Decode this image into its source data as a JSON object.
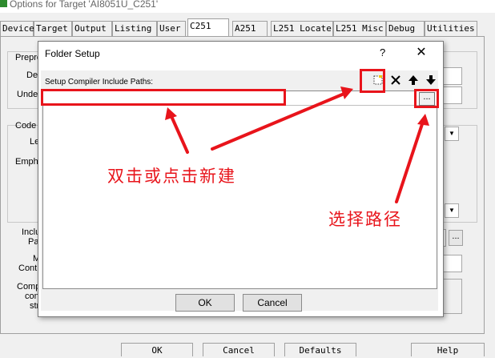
{
  "window": {
    "title": "Options for Target 'AI8051U_C251'"
  },
  "tabs": [
    "Device",
    "Target",
    "Output",
    "Listing",
    "User",
    "C251",
    "A251",
    "L251 Locate",
    "L251 Misc",
    "Debug",
    "Utilities"
  ],
  "background_labels": {
    "prepro": "Prepro",
    "def": "Def",
    "unde": "Unde",
    "code": "Code",
    "le": "Le",
    "empha": "Empha",
    "inclu": "Inclu",
    "path": "Path",
    "m": "M",
    "contr": "Contr",
    "comp": "Comp",
    "cont": "cont",
    "str": "str",
    "browse": "..."
  },
  "dialog": {
    "title": "Folder Setup",
    "help": "?",
    "close": "✕",
    "list_label": "Setup Compiler Include Paths:",
    "browse": "...",
    "ok": "OK",
    "cancel": "Cancel"
  },
  "annotations": {
    "new_hint": "双击或点击新建",
    "path_hint": "选择路径"
  },
  "bottom_buttons": {
    "ok": "OK",
    "cancel": "Cancel",
    "defaults": "Defaults",
    "help": "Help"
  },
  "colors": {
    "annotation": "#e8141b"
  }
}
